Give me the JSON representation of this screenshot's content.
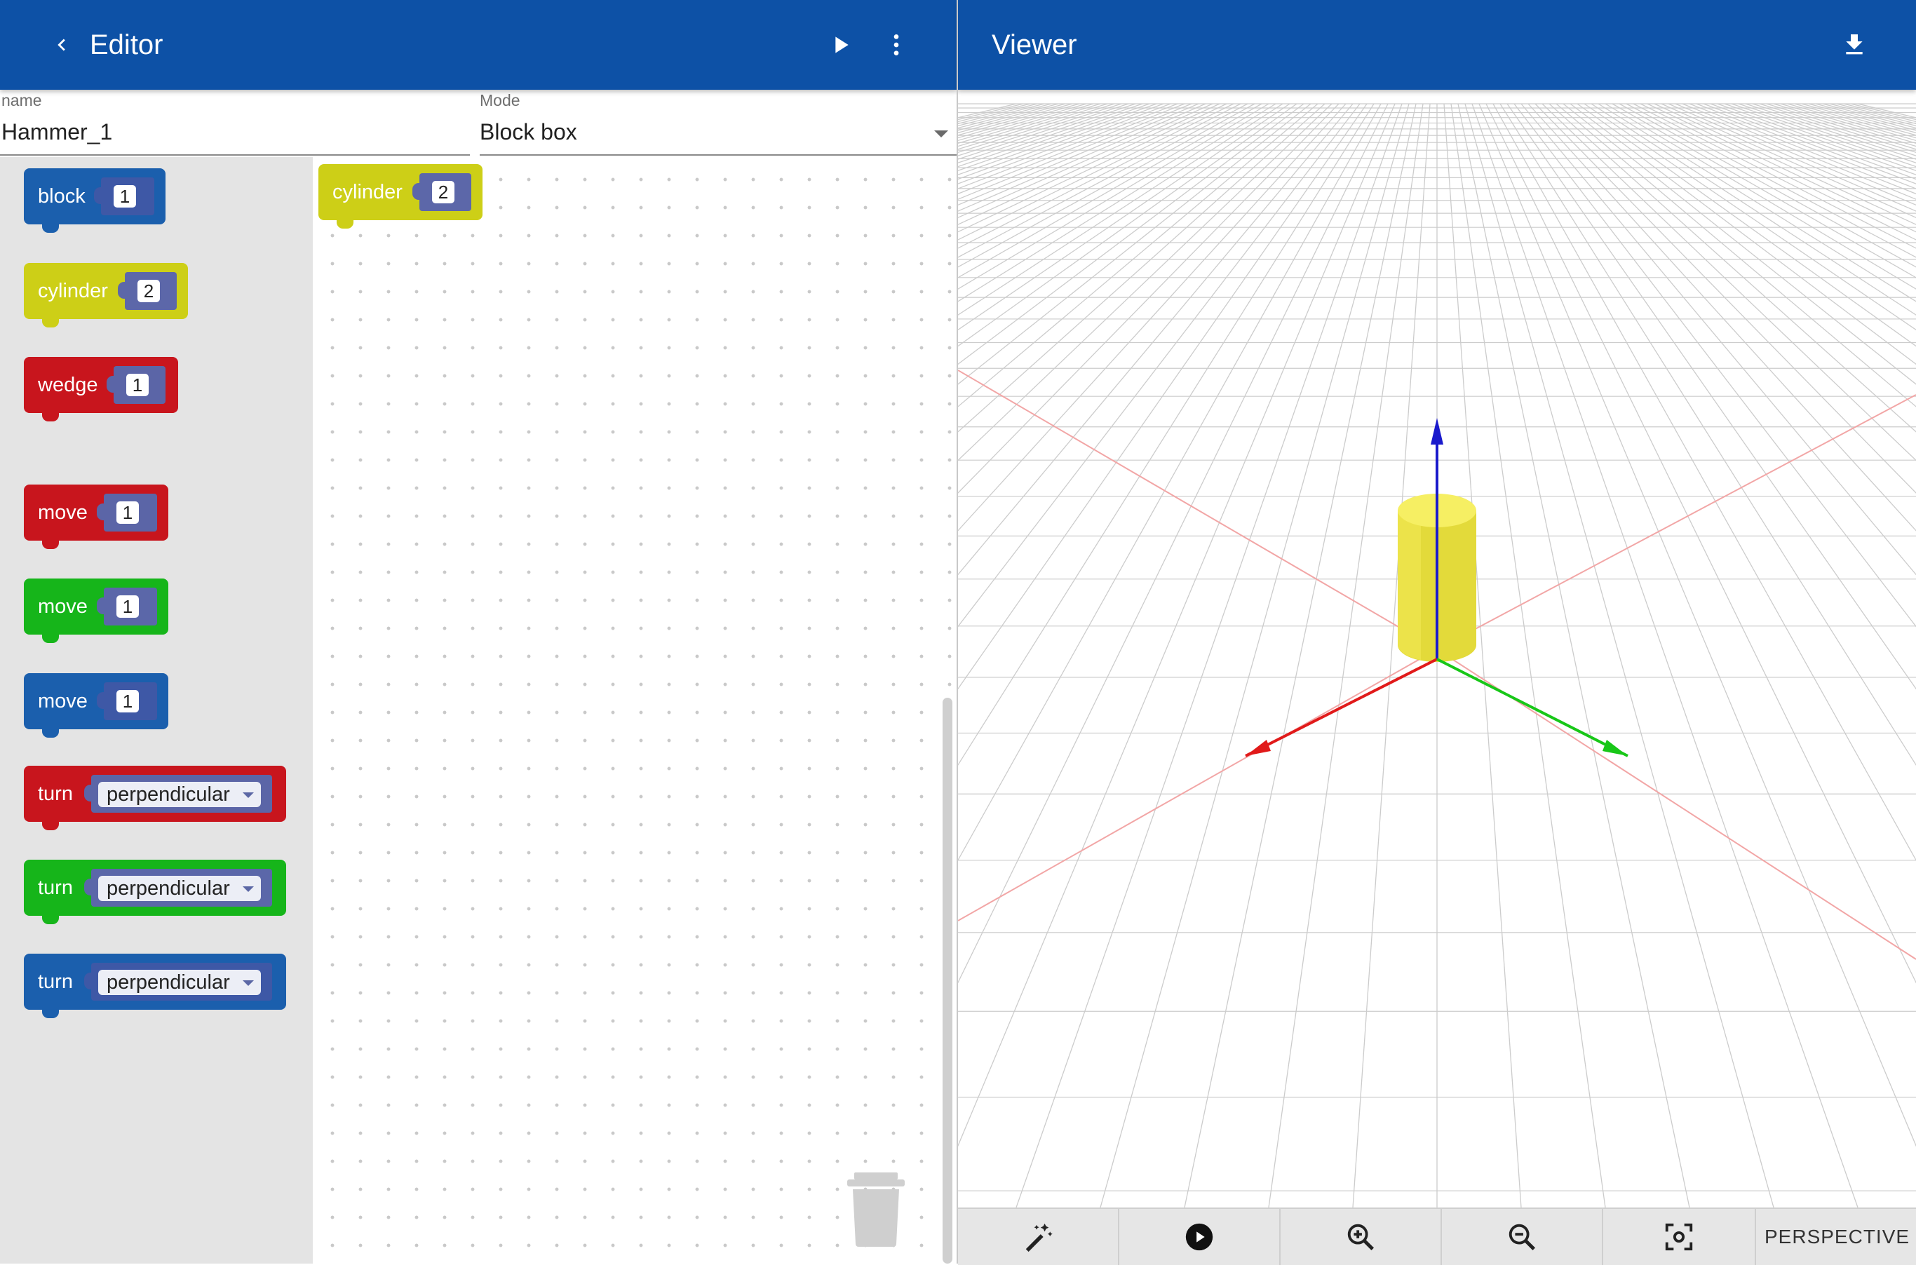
{
  "editor": {
    "title": "Editor",
    "back_icon": "chevron-left-icon",
    "run_icon": "play-icon",
    "menu_icon": "more-vert-icon"
  },
  "viewer": {
    "title": "Viewer",
    "download_icon": "download-icon"
  },
  "form": {
    "name_label": "name",
    "name_value": "Hammer_1",
    "mode_label": "Mode",
    "mode_value": "Block box"
  },
  "palette": [
    {
      "label": "block",
      "value": "1",
      "color": "#1b5fad"
    },
    {
      "label": "cylinder",
      "value": "2",
      "color": "#cdcf17"
    },
    {
      "label": "wedge",
      "value": "1",
      "color": "#c8151d"
    },
    {
      "label": "move",
      "value": "1",
      "color": "#c8151d"
    },
    {
      "label": "move",
      "value": "1",
      "color": "#16b51a"
    },
    {
      "label": "move",
      "value": "1",
      "color": "#1b5fad"
    },
    {
      "label": "turn",
      "value": "perpendicular",
      "color": "#c8151d"
    },
    {
      "label": "turn",
      "value": "perpendicular",
      "color": "#16b51a"
    },
    {
      "label": "turn",
      "value": "perpendicular",
      "color": "#1b5fad"
    }
  ],
  "workspace": {
    "block": {
      "label": "cylinder",
      "value": "2",
      "color": "#cdcf17"
    },
    "trash_icon": "trash-can-icon"
  },
  "scene": {
    "object": "yellow cylinder",
    "axis_colors": {
      "x": "#e11a1a",
      "y": "#18c718",
      "z": "#1a1acc"
    },
    "grid_color": "#cccccc"
  },
  "toolbar": {
    "tools": [
      "magic-wand-icon",
      "play-circle-icon",
      "zoom-in-icon",
      "zoom-out-icon",
      "focus-icon"
    ],
    "camera_mode": "PERSPECTIVE"
  }
}
